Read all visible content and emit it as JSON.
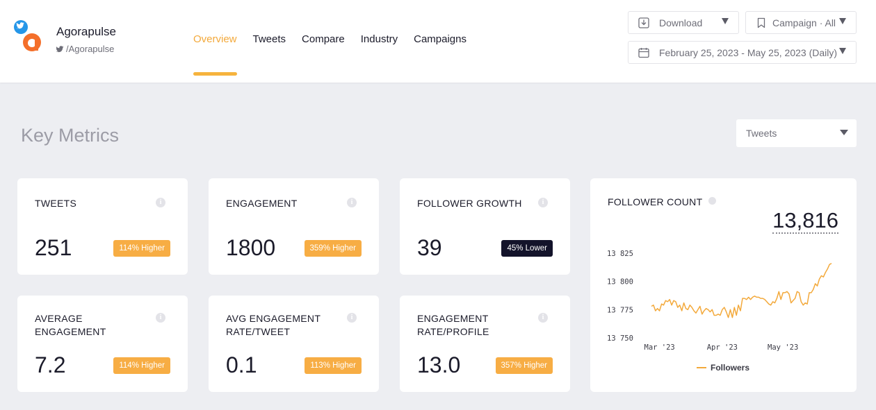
{
  "brand": {
    "name": "Agorapulse",
    "handle": "/Agorapulse"
  },
  "nav": {
    "tabs": [
      "Overview",
      "Tweets",
      "Compare",
      "Industry",
      "Campaigns"
    ],
    "active": "Overview"
  },
  "header_actions": {
    "download_label": "Download",
    "campaign_label": "Campaign · All",
    "date_range": "February 25, 2023 - May 25, 2023 (Daily)"
  },
  "key_metrics": {
    "title": "Key Metrics",
    "metric_select": "Tweets"
  },
  "cards": [
    {
      "label": "TWEETS",
      "value": "251",
      "badge": "114% Higher",
      "badge_color": "#f7ad44"
    },
    {
      "label": "ENGAGEMENT",
      "value": "1800",
      "badge": "359% Higher",
      "badge_color": "#f7ad44"
    },
    {
      "label": "FOLLOWER GROWTH",
      "value": "39",
      "badge": "45% Lower",
      "badge_color": "#13132a"
    },
    {
      "label": "AVERAGE ENGAGEMENT",
      "value": "7.2",
      "badge": "114% Higher",
      "badge_color": "#f7ad44"
    },
    {
      "label": "AVG ENGAGEMENT RATE/TWEET",
      "value": "0.1",
      "badge": "113% Higher",
      "badge_color": "#f7ad44"
    },
    {
      "label": "ENGAGEMENT RATE/PROFILE",
      "value": "13.0",
      "badge": "357% Higher",
      "badge_color": "#f7ad44"
    }
  ],
  "follower_card": {
    "title": "FOLLOWER COUNT",
    "value": "13,816"
  },
  "chart_data": {
    "type": "line",
    "title": "FOLLOWER COUNT",
    "xlabel": "",
    "ylabel": "",
    "yticks": [
      "13 825",
      "13 800",
      "13 775",
      "13 750"
    ],
    "ylim": [
      13750,
      13825
    ],
    "xticks": [
      "Mar '23",
      "Apr '23",
      "May '23"
    ],
    "x_day_of_ticks": [
      4,
      35,
      65
    ],
    "series": [
      {
        "name": "Followers",
        "color": "#f3a93b",
        "x": [
          0,
          1,
          2,
          3,
          4,
          5,
          6,
          7,
          8,
          9,
          10,
          11,
          12,
          13,
          14,
          15,
          16,
          17,
          18,
          19,
          20,
          21,
          22,
          23,
          24,
          25,
          26,
          27,
          28,
          29,
          30,
          31,
          32,
          33,
          34,
          35,
          36,
          37,
          38,
          39,
          40,
          41,
          42,
          43,
          44,
          45,
          46,
          47,
          48,
          49,
          50,
          51,
          52,
          53,
          54,
          55,
          56,
          57,
          58,
          59,
          60,
          61,
          62,
          63,
          64,
          65,
          66,
          67,
          68,
          69,
          70,
          71,
          72,
          73,
          74,
          75,
          76,
          77,
          78,
          79,
          80,
          81,
          82,
          83,
          84,
          85,
          86,
          87,
          88,
          89
        ],
        "values": [
          13778,
          13779,
          13774,
          13776,
          13774,
          13780,
          13779,
          13783,
          13782,
          13784,
          13779,
          13783,
          13782,
          13777,
          13779,
          13774,
          13781,
          13776,
          13775,
          13779,
          13777,
          13774,
          13772,
          13775,
          13778,
          13771,
          13774,
          13776,
          13775,
          13773,
          13775,
          13770,
          13770,
          13771,
          13770,
          13775,
          13777,
          13773,
          13768,
          13775,
          13768,
          13777,
          13770,
          13779,
          13774,
          13785,
          13785,
          13784,
          13786,
          13784,
          13786,
          13787,
          13786,
          13786,
          13785,
          13785,
          13784,
          13782,
          13780,
          13779,
          13782,
          13781,
          13785,
          13791,
          13784,
          13790,
          13790,
          13791,
          13789,
          13781,
          13783,
          13785,
          13791,
          13790,
          13782,
          13779,
          13781,
          13780,
          13790,
          13790,
          13793,
          13798,
          13796,
          13802,
          13805,
          13804,
          13808,
          13811,
          13815,
          13816
        ]
      }
    ],
    "legend": "bottom-center",
    "grid": false
  }
}
